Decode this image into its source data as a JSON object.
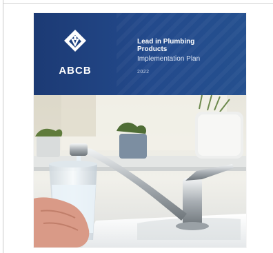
{
  "cover": {
    "logo_text": "ABCB",
    "title_line1": "Lead in Plumbing",
    "title_line2": "Products",
    "subtitle": "Implementation Plan",
    "year": "2022"
  },
  "colors": {
    "banner": "#1e3f7a",
    "text": "#ffffff"
  },
  "icons": [
    "abcb-logo-icon"
  ],
  "image": "kitchen-tap-filling-glass-photo"
}
